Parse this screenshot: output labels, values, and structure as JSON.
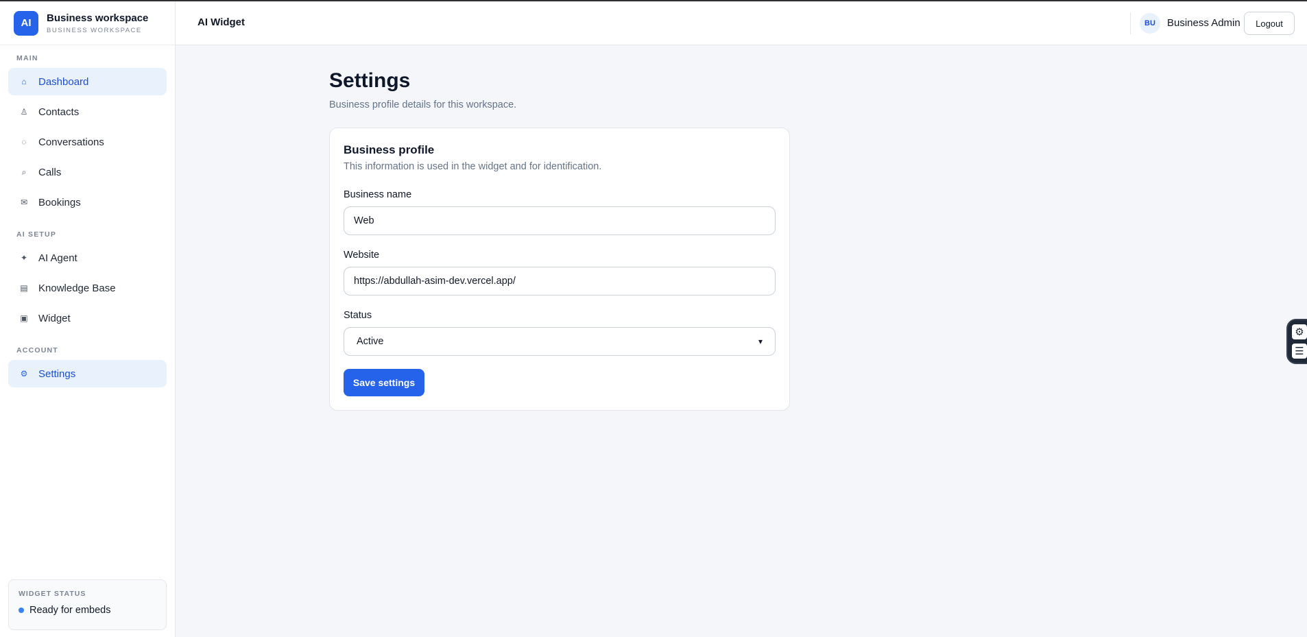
{
  "sidebar": {
    "brand": {
      "logo": "AI",
      "title": "Business workspace",
      "subtitle": "BUSINESS WORKSPACE"
    },
    "sections": {
      "main": "MAIN",
      "ai_setup": "AI SETUP",
      "account": "ACCOUNT"
    },
    "items": [
      {
        "label": "Dashboard",
        "icon": "home-icon",
        "glyph": "⌂"
      },
      {
        "label": "Contacts",
        "icon": "person-icon",
        "glyph": "♙"
      },
      {
        "label": "Conversations",
        "icon": "chat-icon",
        "glyph": "◌"
      },
      {
        "label": "Calls",
        "icon": "phone-icon",
        "glyph": "⌕"
      },
      {
        "label": "Bookings",
        "icon": "mail-icon",
        "glyph": "✉"
      },
      {
        "label": "AI Agent",
        "icon": "sparkle-icon",
        "glyph": "✦"
      },
      {
        "label": "Knowledge Base",
        "icon": "book-icon",
        "glyph": "▤"
      },
      {
        "label": "Widget",
        "icon": "widget-icon",
        "glyph": "▣"
      },
      {
        "label": "Settings",
        "icon": "gear-icon",
        "glyph": "⚙"
      }
    ],
    "widget_status": {
      "label": "WIDGET STATUS",
      "text": "Ready for embeds"
    }
  },
  "header": {
    "title": "AI Widget",
    "avatar": "BU",
    "user_name": "Business Admin",
    "logout_label": "Logout"
  },
  "main": {
    "title": "Settings",
    "subtitle": "Business profile details for this workspace.",
    "card": {
      "title": "Business profile",
      "subtitle": "This information is used in the widget and for identification.",
      "business_name_label": "Business name",
      "business_name_value": "Web",
      "website_label": "Website",
      "website_value": "https://abdullah-asim-dev.vercel.app/",
      "status_label": "Status",
      "status_value": "Active",
      "save_label": "Save settings"
    }
  },
  "colors": {
    "accent": "#2563eb",
    "active_bg": "#e8f1fc",
    "page_bg": "#f4f6f9"
  }
}
